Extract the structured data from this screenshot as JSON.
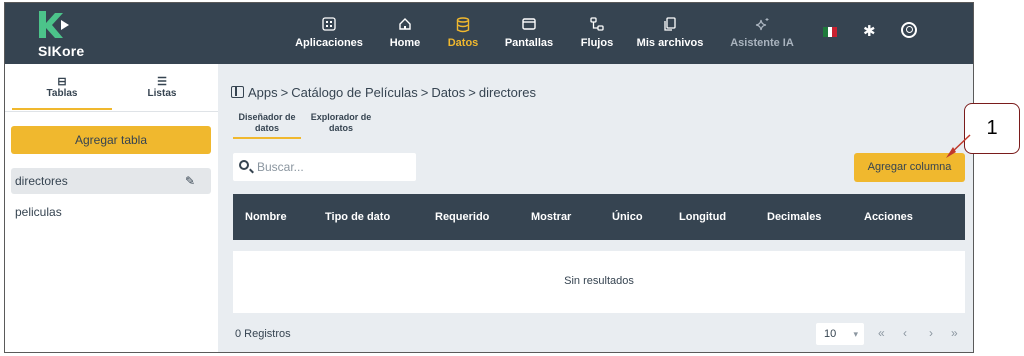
{
  "app": {
    "name": "SIKore"
  },
  "nav": {
    "items": [
      {
        "label": "Aplicaciones",
        "icon": "apps-icon"
      },
      {
        "label": "Home",
        "icon": "home-icon"
      },
      {
        "label": "Datos",
        "icon": "database-icon",
        "active": true
      },
      {
        "label": "Pantallas",
        "icon": "window-icon"
      },
      {
        "label": "Flujos",
        "icon": "flow-icon"
      },
      {
        "label": "Mis archivos",
        "icon": "files-icon"
      },
      {
        "label": "Asistente IA",
        "icon": "sparkle-icon"
      }
    ]
  },
  "sidebar": {
    "tabs": [
      {
        "label": "Tablas",
        "icon": "table-icon"
      },
      {
        "label": "Listas",
        "icon": "list-icon"
      }
    ],
    "add_table_label": "Agregar tabla",
    "items": [
      {
        "label": "directores",
        "selected": true
      },
      {
        "label": "peliculas"
      }
    ]
  },
  "breadcrumb": {
    "root": "Apps",
    "app": "Catálogo de Películas",
    "section": "Datos",
    "table": "directores",
    "separator": ">"
  },
  "subtabs": [
    {
      "line1": "Diseñador de",
      "line2": "datos",
      "active": true
    },
    {
      "line1": "Explorador de",
      "line2": "datos"
    }
  ],
  "search": {
    "placeholder": "Buscar..."
  },
  "add_column_label": "Agregar columna",
  "table": {
    "columns": [
      "Nombre",
      "Tipo de dato",
      "Requerido",
      "Mostrar",
      "Único",
      "Longitud",
      "Decimales",
      "Acciones"
    ],
    "empty_text": "Sin resultados"
  },
  "footer": {
    "records": "0 Registros",
    "page_size": "10",
    "nav": [
      "«",
      "‹",
      "›",
      "»"
    ]
  },
  "callout": {
    "number": "1"
  },
  "colors": {
    "topbar": "#364451",
    "accent": "#f0b82e",
    "background": "#e9edf1",
    "callout_border": "#7a1c1c"
  }
}
